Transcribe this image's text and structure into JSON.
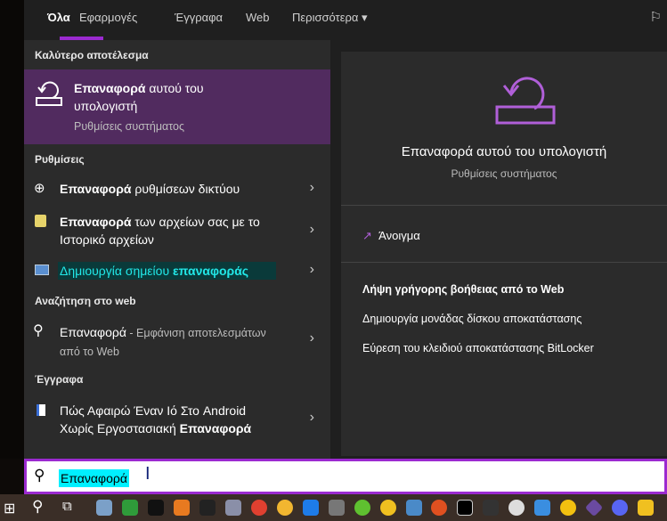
{
  "tabs": [
    {
      "label": "Όλα"
    },
    {
      "label": "Εφαρμογές"
    },
    {
      "label": "Έγγραφα"
    },
    {
      "label": "Web"
    },
    {
      "label": "Περισσότερα"
    }
  ],
  "accent": "#9b2ad0",
  "best_match": {
    "header": "Καλύτερο αποτέλεσμα",
    "title_bold": "Επαναφορά",
    "title_rest": " αυτού του υπολογιστή",
    "subtitle": "Ρυθμίσεις συστήματος",
    "icon": "reset-pc-icon"
  },
  "settings": {
    "header": "Ρυθμίσεις",
    "items": [
      {
        "bold": "Επαναφορά",
        "rest": " ρυθμίσεων δικτύου",
        "icon": "globe-icon"
      },
      {
        "bold": "Επαναφορά",
        "rest": " των αρχείων σας με το Ιστορικό αρχείων",
        "icon": "file-history-icon"
      },
      {
        "pre": "Δημιουργία σημείου ",
        "bold": "επαναφοράς",
        "icon": "system-icon"
      }
    ]
  },
  "web": {
    "header": "Αναζήτηση στο web",
    "query": "Επαναφορά",
    "suffix": " - Εμφάνιση αποτελεσμάτων από το Web"
  },
  "documents": {
    "header": "Έγγραφα",
    "pre": "Πώς Αφαιρώ Έναν Ιό Στο Android Χωρίς Εργοστασιακή ",
    "bold": "Επαναφορά"
  },
  "preview": {
    "title": "Επαναφορά αυτού του υπολογιστή",
    "subtitle": "Ρυθμίσεις συστήματος",
    "open": "Άνοιγμα",
    "help_header": "Λήψη γρήγορης βοήθειας από το Web",
    "links": [
      "Δημιουργία μονάδας δίσκου αποκατάστασης",
      "Εύρεση του κλειδιού αποκατάστασης BitLocker"
    ]
  },
  "search": {
    "value": "Επαναφορά"
  }
}
